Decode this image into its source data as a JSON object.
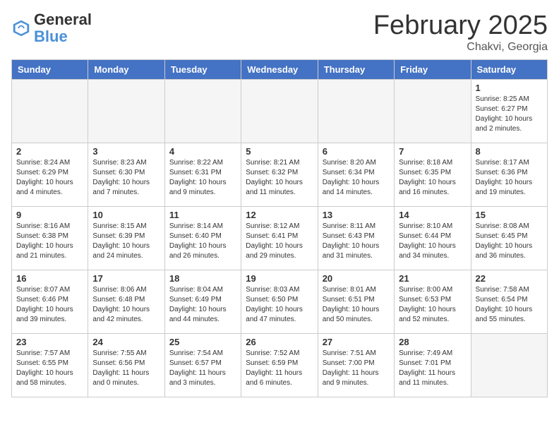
{
  "header": {
    "logo_general": "General",
    "logo_blue": "Blue",
    "month_title": "February 2025",
    "location": "Chakvi, Georgia"
  },
  "calendar": {
    "days_of_week": [
      "Sunday",
      "Monday",
      "Tuesday",
      "Wednesday",
      "Thursday",
      "Friday",
      "Saturday"
    ],
    "weeks": [
      [
        {
          "day": null
        },
        {
          "day": null
        },
        {
          "day": null
        },
        {
          "day": null
        },
        {
          "day": null
        },
        {
          "day": null
        },
        {
          "day": 1,
          "sunrise": "8:25 AM",
          "sunset": "6:27 PM",
          "daylight": "10 hours and 2 minutes."
        }
      ],
      [
        {
          "day": 2,
          "sunrise": "8:24 AM",
          "sunset": "6:29 PM",
          "daylight": "10 hours and 4 minutes."
        },
        {
          "day": 3,
          "sunrise": "8:23 AM",
          "sunset": "6:30 PM",
          "daylight": "10 hours and 7 minutes."
        },
        {
          "day": 4,
          "sunrise": "8:22 AM",
          "sunset": "6:31 PM",
          "daylight": "10 hours and 9 minutes."
        },
        {
          "day": 5,
          "sunrise": "8:21 AM",
          "sunset": "6:32 PM",
          "daylight": "10 hours and 11 minutes."
        },
        {
          "day": 6,
          "sunrise": "8:20 AM",
          "sunset": "6:34 PM",
          "daylight": "10 hours and 14 minutes."
        },
        {
          "day": 7,
          "sunrise": "8:18 AM",
          "sunset": "6:35 PM",
          "daylight": "10 hours and 16 minutes."
        },
        {
          "day": 8,
          "sunrise": "8:17 AM",
          "sunset": "6:36 PM",
          "daylight": "10 hours and 19 minutes."
        }
      ],
      [
        {
          "day": 9,
          "sunrise": "8:16 AM",
          "sunset": "6:38 PM",
          "daylight": "10 hours and 21 minutes."
        },
        {
          "day": 10,
          "sunrise": "8:15 AM",
          "sunset": "6:39 PM",
          "daylight": "10 hours and 24 minutes."
        },
        {
          "day": 11,
          "sunrise": "8:14 AM",
          "sunset": "6:40 PM",
          "daylight": "10 hours and 26 minutes."
        },
        {
          "day": 12,
          "sunrise": "8:12 AM",
          "sunset": "6:41 PM",
          "daylight": "10 hours and 29 minutes."
        },
        {
          "day": 13,
          "sunrise": "8:11 AM",
          "sunset": "6:43 PM",
          "daylight": "10 hours and 31 minutes."
        },
        {
          "day": 14,
          "sunrise": "8:10 AM",
          "sunset": "6:44 PM",
          "daylight": "10 hours and 34 minutes."
        },
        {
          "day": 15,
          "sunrise": "8:08 AM",
          "sunset": "6:45 PM",
          "daylight": "10 hours and 36 minutes."
        }
      ],
      [
        {
          "day": 16,
          "sunrise": "8:07 AM",
          "sunset": "6:46 PM",
          "daylight": "10 hours and 39 minutes."
        },
        {
          "day": 17,
          "sunrise": "8:06 AM",
          "sunset": "6:48 PM",
          "daylight": "10 hours and 42 minutes."
        },
        {
          "day": 18,
          "sunrise": "8:04 AM",
          "sunset": "6:49 PM",
          "daylight": "10 hours and 44 minutes."
        },
        {
          "day": 19,
          "sunrise": "8:03 AM",
          "sunset": "6:50 PM",
          "daylight": "10 hours and 47 minutes."
        },
        {
          "day": 20,
          "sunrise": "8:01 AM",
          "sunset": "6:51 PM",
          "daylight": "10 hours and 50 minutes."
        },
        {
          "day": 21,
          "sunrise": "8:00 AM",
          "sunset": "6:53 PM",
          "daylight": "10 hours and 52 minutes."
        },
        {
          "day": 22,
          "sunrise": "7:58 AM",
          "sunset": "6:54 PM",
          "daylight": "10 hours and 55 minutes."
        }
      ],
      [
        {
          "day": 23,
          "sunrise": "7:57 AM",
          "sunset": "6:55 PM",
          "daylight": "10 hours and 58 minutes."
        },
        {
          "day": 24,
          "sunrise": "7:55 AM",
          "sunset": "6:56 PM",
          "daylight": "11 hours and 0 minutes."
        },
        {
          "day": 25,
          "sunrise": "7:54 AM",
          "sunset": "6:57 PM",
          "daylight": "11 hours and 3 minutes."
        },
        {
          "day": 26,
          "sunrise": "7:52 AM",
          "sunset": "6:59 PM",
          "daylight": "11 hours and 6 minutes."
        },
        {
          "day": 27,
          "sunrise": "7:51 AM",
          "sunset": "7:00 PM",
          "daylight": "11 hours and 9 minutes."
        },
        {
          "day": 28,
          "sunrise": "7:49 AM",
          "sunset": "7:01 PM",
          "daylight": "11 hours and 11 minutes."
        },
        {
          "day": null
        }
      ]
    ]
  }
}
